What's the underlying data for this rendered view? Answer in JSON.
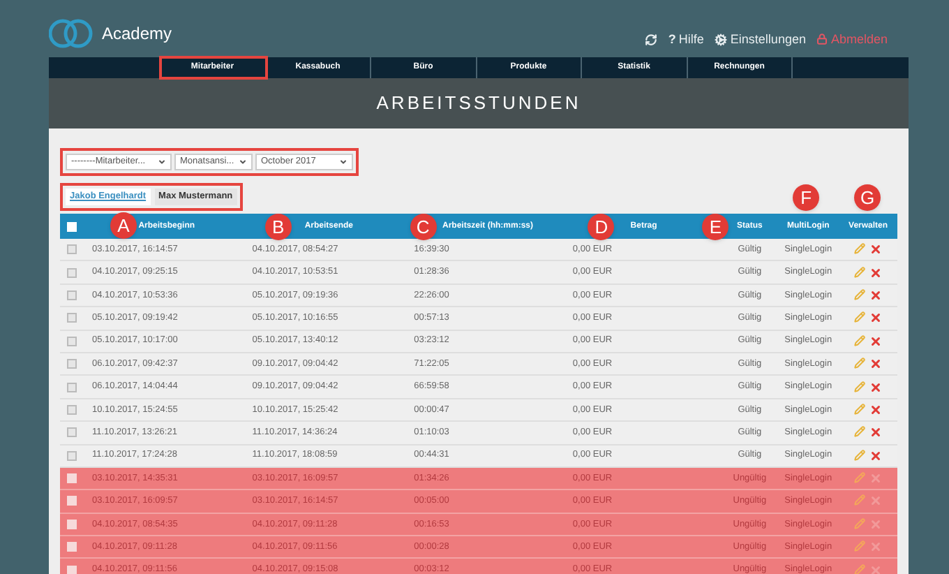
{
  "brand": {
    "name": "Academy"
  },
  "header_links": [
    {
      "kind": "refresh"
    },
    {
      "kind": "help",
      "glyph": "?",
      "label": "Hilfe"
    },
    {
      "kind": "settings",
      "label": "Einstellungen"
    },
    {
      "kind": "logout",
      "label": "Abmelden"
    }
  ],
  "nav": [
    {
      "label": "Mitarbeiter",
      "highlighted": true
    },
    {
      "label": "Kassabuch",
      "highlighted": false
    },
    {
      "label": "Büro",
      "highlighted": false
    },
    {
      "label": "Produkte",
      "highlighted": false
    },
    {
      "label": "Statistik",
      "highlighted": false
    },
    {
      "label": "Rechnungen",
      "highlighted": false
    }
  ],
  "page_title": "ARBEITSSTUNDEN",
  "filters": {
    "highlighted": true,
    "selects": [
      {
        "value": "--------Mitarbeiter..."
      },
      {
        "value": "Monatsansi..."
      },
      {
        "value": "October 2017"
      }
    ]
  },
  "employee_tabs": {
    "highlighted": true,
    "tabs": [
      {
        "label": "Jakob Engelhardt",
        "selected": true
      },
      {
        "label": "Max Mustermann",
        "selected": false
      }
    ]
  },
  "table": {
    "select_all": {
      "checked": false
    },
    "columns": [
      {
        "label": "Arbeitsbeginn",
        "marker": "A"
      },
      {
        "label": "Arbeitsende",
        "marker": "B"
      },
      {
        "label": "Arbeitszeit (hh:mm:ss)",
        "marker": "C"
      },
      {
        "label": "Betrag",
        "marker": "D"
      },
      {
        "label": "Status",
        "marker": "E"
      },
      {
        "label": "MultiLogin",
        "marker": "F"
      },
      {
        "label": "Verwalten",
        "marker": "G"
      }
    ],
    "rows": [
      {
        "checked": false,
        "valid": true,
        "start": "03.10.2017, 16:14:57",
        "end": "04.10.2017, 08:54:27",
        "duration": "16:39:30",
        "amount": "0,00 EUR",
        "status": "Gültig",
        "login": "SingleLogin"
      },
      {
        "checked": false,
        "valid": true,
        "start": "04.10.2017, 09:25:15",
        "end": "04.10.2017, 10:53:51",
        "duration": "01:28:36",
        "amount": "0,00 EUR",
        "status": "Gültig",
        "login": "SingleLogin"
      },
      {
        "checked": false,
        "valid": true,
        "start": "04.10.2017, 10:53:36",
        "end": "05.10.2017, 09:19:36",
        "duration": "22:26:00",
        "amount": "0,00 EUR",
        "status": "Gültig",
        "login": "SingleLogin"
      },
      {
        "checked": false,
        "valid": true,
        "start": "05.10.2017, 09:19:42",
        "end": "05.10.2017, 10:16:55",
        "duration": "00:57:13",
        "amount": "0,00 EUR",
        "status": "Gültig",
        "login": "SingleLogin"
      },
      {
        "checked": false,
        "valid": true,
        "start": "05.10.2017, 10:17:00",
        "end": "05.10.2017, 13:40:12",
        "duration": "03:23:12",
        "amount": "0,00 EUR",
        "status": "Gültig",
        "login": "SingleLogin"
      },
      {
        "checked": false,
        "valid": true,
        "start": "06.10.2017, 09:42:37",
        "end": "09.10.2017, 09:04:42",
        "duration": "71:22:05",
        "amount": "0,00 EUR",
        "status": "Gültig",
        "login": "SingleLogin"
      },
      {
        "checked": false,
        "valid": true,
        "start": "06.10.2017, 14:04:44",
        "end": "09.10.2017, 09:04:42",
        "duration": "66:59:58",
        "amount": "0,00 EUR",
        "status": "Gültig",
        "login": "SingleLogin"
      },
      {
        "checked": false,
        "valid": true,
        "start": "10.10.2017, 15:24:55",
        "end": "10.10.2017, 15:25:42",
        "duration": "00:00:47",
        "amount": "0,00 EUR",
        "status": "Gültig",
        "login": "SingleLogin"
      },
      {
        "checked": false,
        "valid": true,
        "start": "11.10.2017, 13:26:21",
        "end": "11.10.2017, 14:36:24",
        "duration": "01:10:03",
        "amount": "0,00 EUR",
        "status": "Gültig",
        "login": "SingleLogin"
      },
      {
        "checked": false,
        "valid": true,
        "start": "11.10.2017, 17:24:28",
        "end": "11.10.2017, 18:08:59",
        "duration": "00:44:31",
        "amount": "0,00 EUR",
        "status": "Gültig",
        "login": "SingleLogin"
      },
      {
        "checked": false,
        "valid": false,
        "start": "03.10.2017, 14:35:31",
        "end": "03.10.2017, 16:09:57",
        "duration": "01:34:26",
        "amount": "0,00 EUR",
        "status": "Ungültig",
        "login": "SingleLogin"
      },
      {
        "checked": false,
        "valid": false,
        "start": "03.10.2017, 16:09:57",
        "end": "03.10.2017, 16:14:57",
        "duration": "00:05:00",
        "amount": "0,00 EUR",
        "status": "Ungültig",
        "login": "SingleLogin"
      },
      {
        "checked": false,
        "valid": false,
        "start": "04.10.2017, 08:54:35",
        "end": "04.10.2017, 09:11:28",
        "duration": "00:16:53",
        "amount": "0,00 EUR",
        "status": "Ungültig",
        "login": "SingleLogin"
      },
      {
        "checked": false,
        "valid": false,
        "start": "04.10.2017, 09:11:28",
        "end": "04.10.2017, 09:11:56",
        "duration": "00:00:28",
        "amount": "0,00 EUR",
        "status": "Ungültig",
        "login": "SingleLogin"
      },
      {
        "checked": false,
        "valid": false,
        "start": "04.10.2017, 09:11:56",
        "end": "04.10.2017, 09:15:08",
        "duration": "00:03:12",
        "amount": "0,00 EUR",
        "status": "Ungültig",
        "login": "SingleLogin"
      }
    ]
  }
}
